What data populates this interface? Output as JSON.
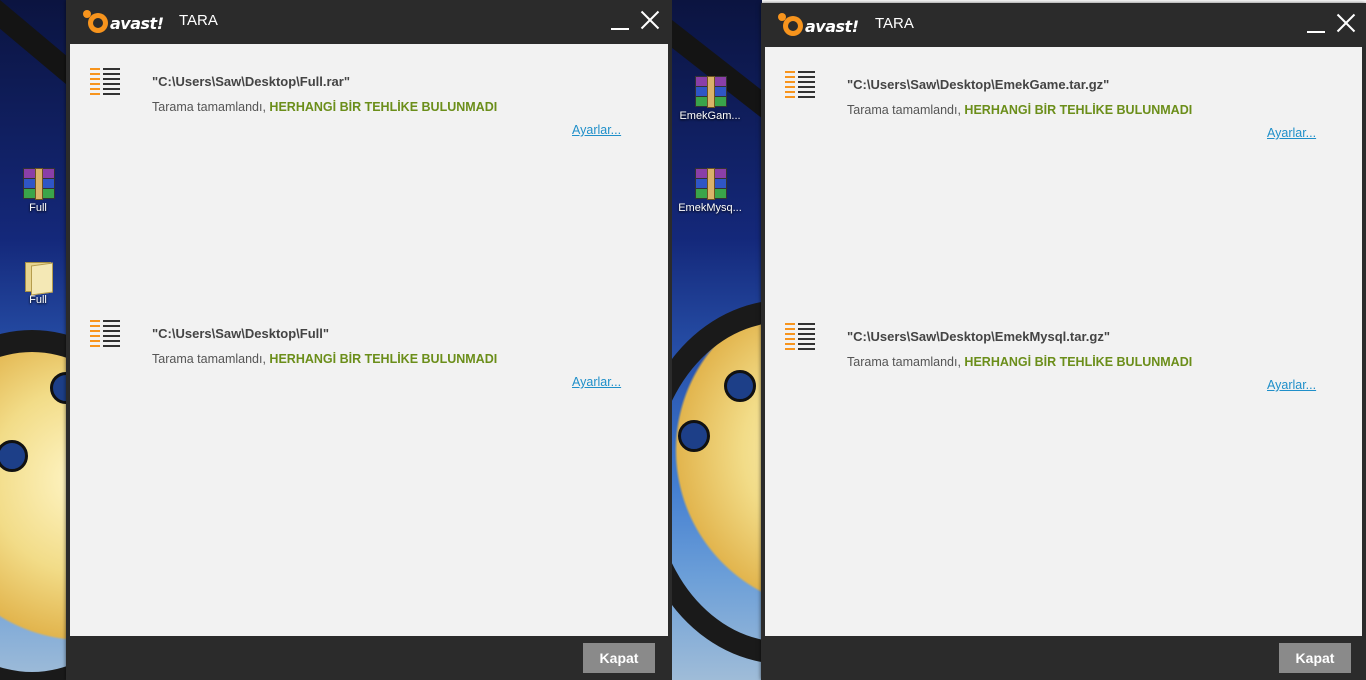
{
  "left": {
    "desktop_icons": [
      {
        "label": "Full",
        "type": "rar"
      },
      {
        "label": "Full",
        "type": "folder"
      }
    ],
    "window": {
      "brand": "avast!",
      "title": "TARA",
      "results": [
        {
          "path": "\"C:\\Users\\Saw\\Desktop\\Full.rar\"",
          "status_prefix": "Tarama tamamlandı, ",
          "status_result": "HERHANGİ BİR TEHLİKE BULUNMADI",
          "settings_link": "Ayarlar..."
        },
        {
          "path": "\"C:\\Users\\Saw\\Desktop\\Full\"",
          "status_prefix": "Tarama tamamlandı, ",
          "status_result": "HERHANGİ BİR TEHLİKE BULUNMADI",
          "settings_link": "Ayarlar..."
        }
      ],
      "close_button": "Kapat"
    }
  },
  "right": {
    "desktop_icons": [
      {
        "label": "EmekGam...",
        "type": "rar"
      },
      {
        "label": "EmekMysq...",
        "type": "rar"
      }
    ],
    "window": {
      "brand": "avast!",
      "title": "TARA",
      "results": [
        {
          "path": "\"C:\\Users\\Saw\\Desktop\\EmekGame.tar.gz\"",
          "status_prefix": "Tarama tamamlandı, ",
          "status_result": "HERHANGİ BİR TEHLİKE BULUNMADI",
          "settings_link": "Ayarlar..."
        },
        {
          "path": "\"C:\\Users\\Saw\\Desktop\\EmekMysql.tar.gz\"",
          "status_prefix": "Tarama tamamlandı, ",
          "status_result": "HERHANGİ BİR TEHLİKE BULUNMADI",
          "settings_link": "Ayarlar..."
        }
      ],
      "close_button": "Kapat"
    }
  },
  "colors": {
    "titlebar": "#2b2b2b",
    "content_bg": "#f2f2f2",
    "brand_orange": "#f7941d",
    "status_ok_green": "#6b8e1a",
    "link_blue": "#1f8fc9",
    "button_gray": "#8a8a8a"
  }
}
